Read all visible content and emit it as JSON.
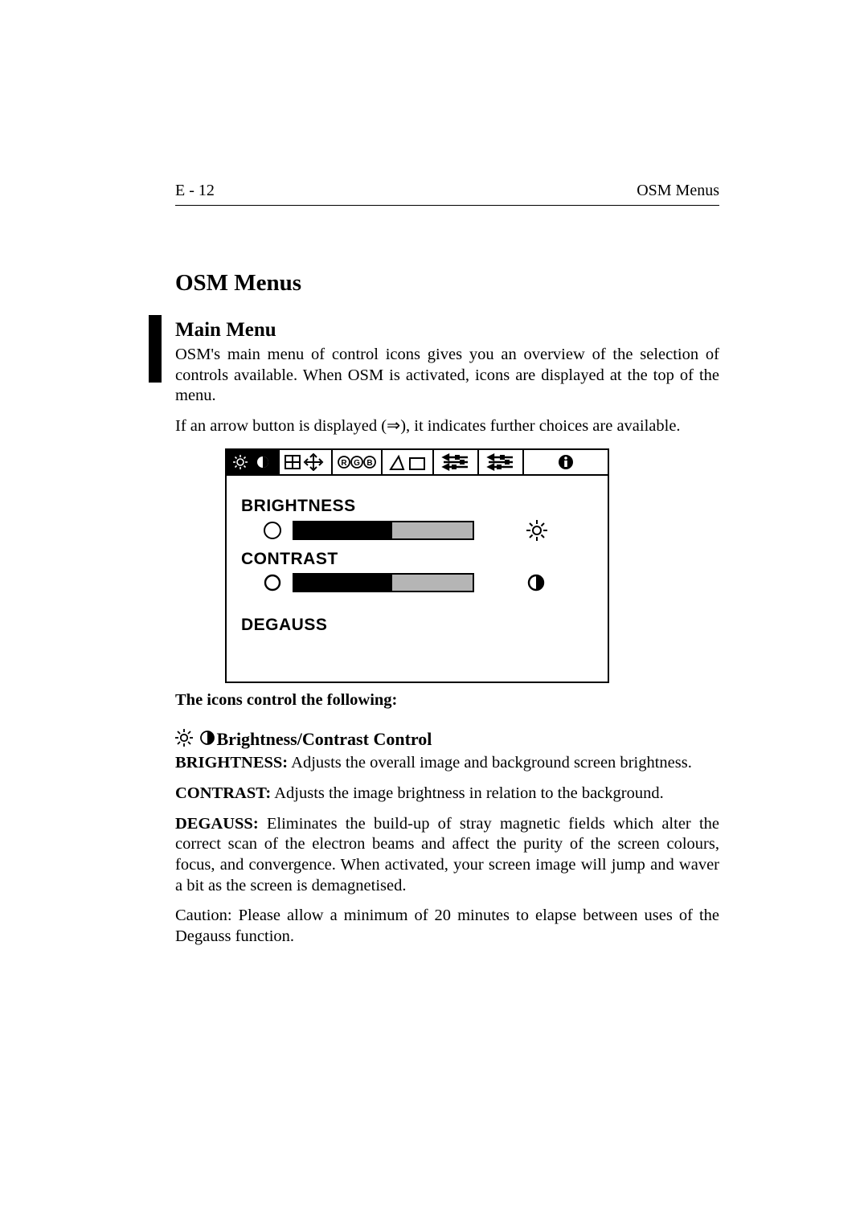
{
  "header": {
    "page_num": "E - 12",
    "section": "OSM Menus"
  },
  "h1": "OSM Menus",
  "h2": "Main Menu",
  "p1": "OSM's main menu of control icons gives you an overview of the selection of controls available. When OSM is activated, icons are displayed at the top of the menu.",
  "p2_a": "If an arrow button is displayed (",
  "p2_arrow": "⇒",
  "p2_b": "), it indicates further choices are available.",
  "osm": {
    "brightness_label": "BRIGHTNESS",
    "contrast_label": "CONTRAST",
    "degauss_label": "DEGAUSS",
    "brightness_fill_pct": 55,
    "contrast_fill_pct": 55
  },
  "caption": "The icons control the following:",
  "section_title": "Brightness/Contrast Control",
  "b1_label": "BRIGHTNESS:",
  "b1_text": " Adjusts the overall image and background screen brightness.",
  "b2_label": "CONTRAST:",
  "b2_text": " Adjusts the image brightness in relation to the background.",
  "b3_label": "DEGAUSS:",
  "b3_text": " Eliminates the build-up of stray magnetic fields which alter the correct scan of the electron beams and affect the purity of the screen colours, focus, and convergence. When activated, your screen image will jump and waver a bit as the screen is demagnetised.",
  "b4": "Caution: Please allow a minimum of 20 minutes to elapse between uses of the Degauss function."
}
